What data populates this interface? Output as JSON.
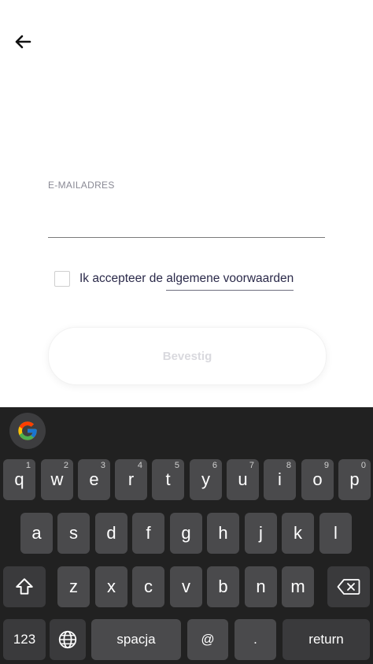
{
  "header": {
    "back_icon": "arrow-left-icon"
  },
  "form": {
    "email_label": "E-MAILADRES",
    "email_value": "",
    "terms_prefix": "Ik accepteer de ",
    "terms_link": "algemene voorwaarden",
    "confirm_label": "Bevestig"
  },
  "keyboard": {
    "google_icon": "google-g-icon",
    "row1": [
      {
        "letter": "q",
        "num": "1"
      },
      {
        "letter": "w",
        "num": "2"
      },
      {
        "letter": "e",
        "num": "3"
      },
      {
        "letter": "r",
        "num": "4"
      },
      {
        "letter": "t",
        "num": "5"
      },
      {
        "letter": "y",
        "num": "6"
      },
      {
        "letter": "u",
        "num": "7"
      },
      {
        "letter": "i",
        "num": "8"
      },
      {
        "letter": "o",
        "num": "9"
      },
      {
        "letter": "p",
        "num": "0"
      }
    ],
    "row2": [
      "a",
      "s",
      "d",
      "f",
      "g",
      "h",
      "j",
      "k",
      "l"
    ],
    "row3": [
      "z",
      "x",
      "c",
      "v",
      "b",
      "n",
      "m"
    ],
    "numbers_key": "123",
    "space_key": "spacja",
    "at_key": "@",
    "dot_key": ".",
    "return_key": "return"
  },
  "colors": {
    "keyboard_bg": "#212121",
    "key_bg": "#4a4a4c",
    "text_dark": "#2b2a4a"
  }
}
